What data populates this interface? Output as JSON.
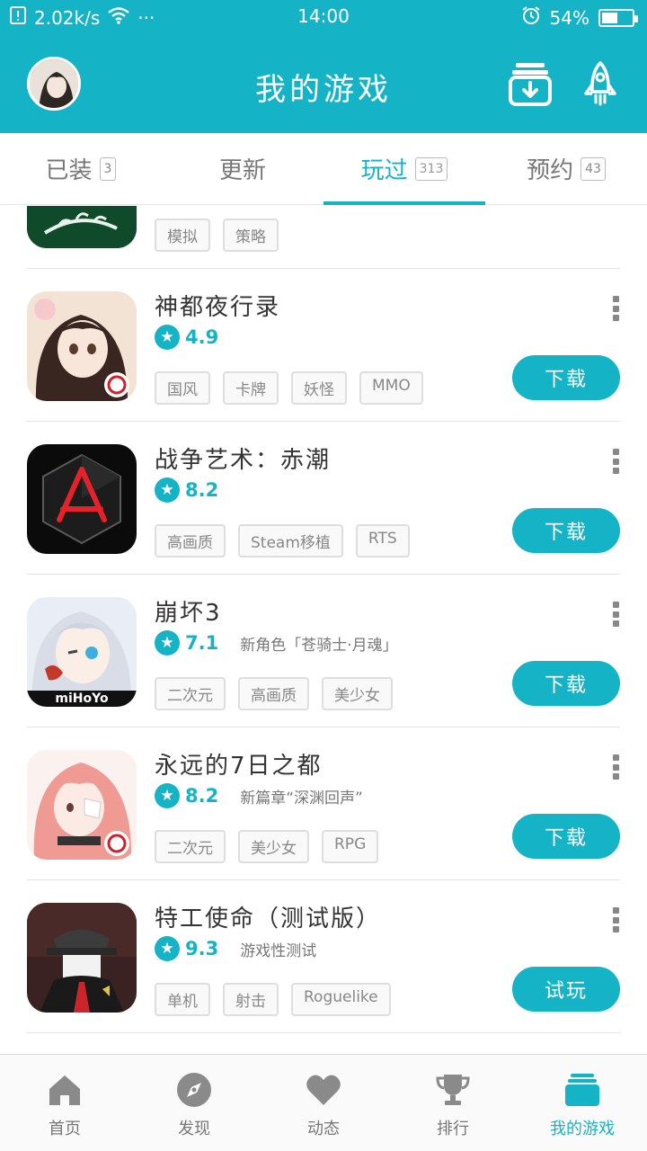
{
  "status_bar": {
    "network_speed": "2.02k/s",
    "dots": "···",
    "time": "14:00",
    "battery": "54%",
    "battery_level": 0.54
  },
  "header": {
    "title": "我的游戏"
  },
  "tabs": [
    {
      "label": "已装",
      "count": "3",
      "active": false
    },
    {
      "label": "更新",
      "count": "",
      "active": false
    },
    {
      "label": "玩过",
      "count": "313",
      "active": true
    },
    {
      "label": "预约",
      "count": "43",
      "active": false
    }
  ],
  "partial_row": {
    "tags": [
      "模拟",
      "策略"
    ]
  },
  "games": [
    {
      "name": "神都夜行录",
      "score": "4.9",
      "note": "",
      "tags": [
        "国风",
        "卡牌",
        "妖怪",
        "MMO"
      ],
      "button": "下载"
    },
    {
      "name": "战争艺术：赤潮",
      "score": "8.2",
      "note": "",
      "tags": [
        "高画质",
        "Steam移植",
        "RTS"
      ],
      "button": "下载"
    },
    {
      "name": "崩坏3",
      "score": "7.1",
      "note": "新角色「苍骑士·月魂」",
      "tags": [
        "二次元",
        "高画质",
        "美少女"
      ],
      "button": "下载"
    },
    {
      "name": "永远的7日之都",
      "score": "8.2",
      "note": "新篇章“深渊回声”",
      "tags": [
        "二次元",
        "美少女",
        "RPG"
      ],
      "button": "下载"
    },
    {
      "name": "特工使命（测试版）",
      "score": "9.3",
      "note": "游戏性测试",
      "tags": [
        "单机",
        "射击",
        "Roguelike"
      ],
      "button": "试玩"
    }
  ],
  "icon_text": {
    "mihoyo": "miHoYo"
  },
  "bottom_nav": [
    {
      "label": "首页",
      "icon": "home-icon",
      "active": false
    },
    {
      "label": "发现",
      "icon": "compass-icon",
      "active": false
    },
    {
      "label": "动态",
      "icon": "heart-icon",
      "active": false
    },
    {
      "label": "排行",
      "icon": "trophy-icon",
      "active": false
    },
    {
      "label": "我的游戏",
      "icon": "stack-icon",
      "active": true
    }
  ],
  "colors": {
    "accent": "#14b4c6",
    "text": "#333333",
    "muted": "#888888"
  }
}
